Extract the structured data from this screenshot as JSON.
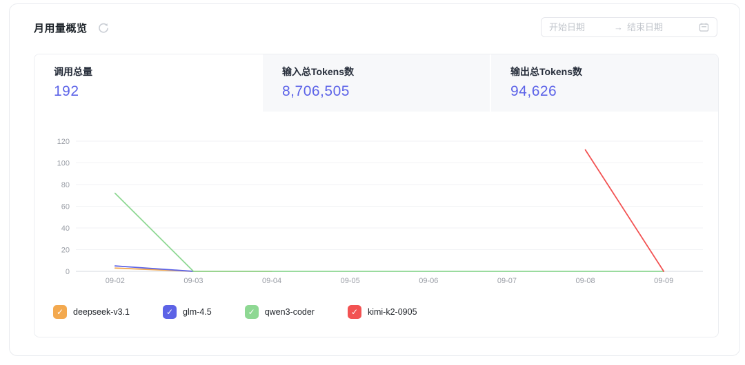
{
  "header": {
    "title": "月用量概览",
    "refresh_icon": "refresh"
  },
  "date_picker": {
    "start_placeholder": "开始日期",
    "separator": "→",
    "end_placeholder": "结束日期",
    "calendar_icon": "calendar"
  },
  "stats": [
    {
      "label": "调用总量",
      "value": "192",
      "active": true
    },
    {
      "label": "输入总Tokens数",
      "value": "8,706,505",
      "active": false
    },
    {
      "label": "输出总Tokens数",
      "value": "94,626",
      "active": false
    }
  ],
  "chart_data": {
    "type": "line",
    "categories": [
      "09-02",
      "09-03",
      "09-04",
      "09-05",
      "09-06",
      "09-07",
      "09-08",
      "09-09"
    ],
    "series": [
      {
        "name": "deepseek-v3.1",
        "color": "#f3a94f",
        "values": [
          3,
          0,
          0,
          null,
          null,
          null,
          null,
          null
        ]
      },
      {
        "name": "glm-4.5",
        "color": "#5d63e6",
        "values": [
          5,
          0,
          null,
          null,
          null,
          null,
          null,
          null
        ]
      },
      {
        "name": "qwen3-coder",
        "color": "#8ed893",
        "values": [
          72,
          0,
          0,
          0,
          0,
          0,
          0,
          0
        ]
      },
      {
        "name": "kimi-k2-0905",
        "color": "#f25252",
        "values": [
          null,
          null,
          null,
          null,
          null,
          null,
          112,
          0
        ]
      }
    ],
    "title": "",
    "xlabel": "",
    "ylabel": "",
    "ylim": [
      0,
      120
    ],
    "yticks": [
      0,
      20,
      40,
      60,
      80,
      100,
      120
    ],
    "grid": true,
    "legend_position": "bottom",
    "colors": {
      "axis_line": "#e4e6ea",
      "grid_line": "#f1f2f5",
      "tick_text": "#9a9ea6"
    }
  },
  "theme": {
    "accent": "#5c63e8",
    "tab_inactive_bg": "#f7f8fa",
    "border": "#e9ebef",
    "placeholder": "#c2c6cc"
  }
}
